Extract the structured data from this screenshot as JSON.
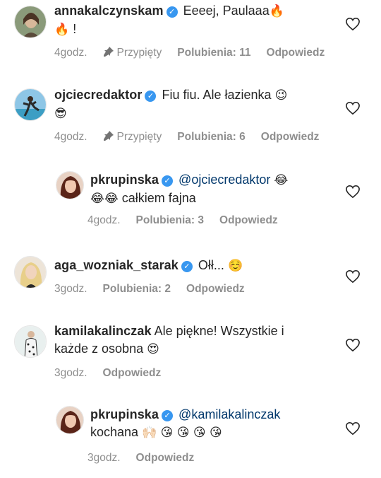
{
  "comments": [
    {
      "username": "annakalczynskam",
      "text_line1": "Eeeej, Paulaaa",
      "emoji_line1": "🔥",
      "emoji_line2": "🔥",
      "text_line2": "!",
      "time": "4godz.",
      "pinned_label": "Przypięty",
      "likes": "Polubienia: 11",
      "reply": "Odpowiedz"
    },
    {
      "username": "ojciecredaktor",
      "text_line1": "Fiu fiu. Ale łazienka",
      "emoji_line1": "😉",
      "emoji_line2": "😎",
      "time": "4godz.",
      "pinned_label": "Przypięty",
      "likes": "Polubienia: 6",
      "reply": "Odpowiedz"
    },
    {
      "username": "pkrupinska",
      "mention": "@ojciecredaktor",
      "emoji_line1": "😂",
      "emoji_line2": "😂😂",
      "text_line2": "całkiem fajna",
      "time": "4godz.",
      "likes": "Polubienia: 3",
      "reply": "Odpowiedz"
    },
    {
      "username": "aga_wozniak_starak",
      "text_line1": "Ołł...",
      "emoji_line1": "☺️",
      "time": "3godz.",
      "likes": "Polubienia: 2",
      "reply": "Odpowiedz"
    },
    {
      "username": "kamilakalinczak",
      "text_line1": "Ale piękne! Wszystkie i",
      "text_line2": "każde z osobna",
      "emoji_line2": "😍",
      "time": "3godz.",
      "reply": "Odpowiedz"
    },
    {
      "username": "pkrupinska",
      "mention": "@kamilakalinczak",
      "text_line2": "kochana",
      "emoji_line2": "🙌🏻 😘 😘 😘 😘",
      "time": "3godz.",
      "reply": "Odpowiedz"
    }
  ],
  "colors": {
    "text": "#262626",
    "meta": "#8e8e8e",
    "mention": "#00376b",
    "verified": "#3897f0"
  }
}
